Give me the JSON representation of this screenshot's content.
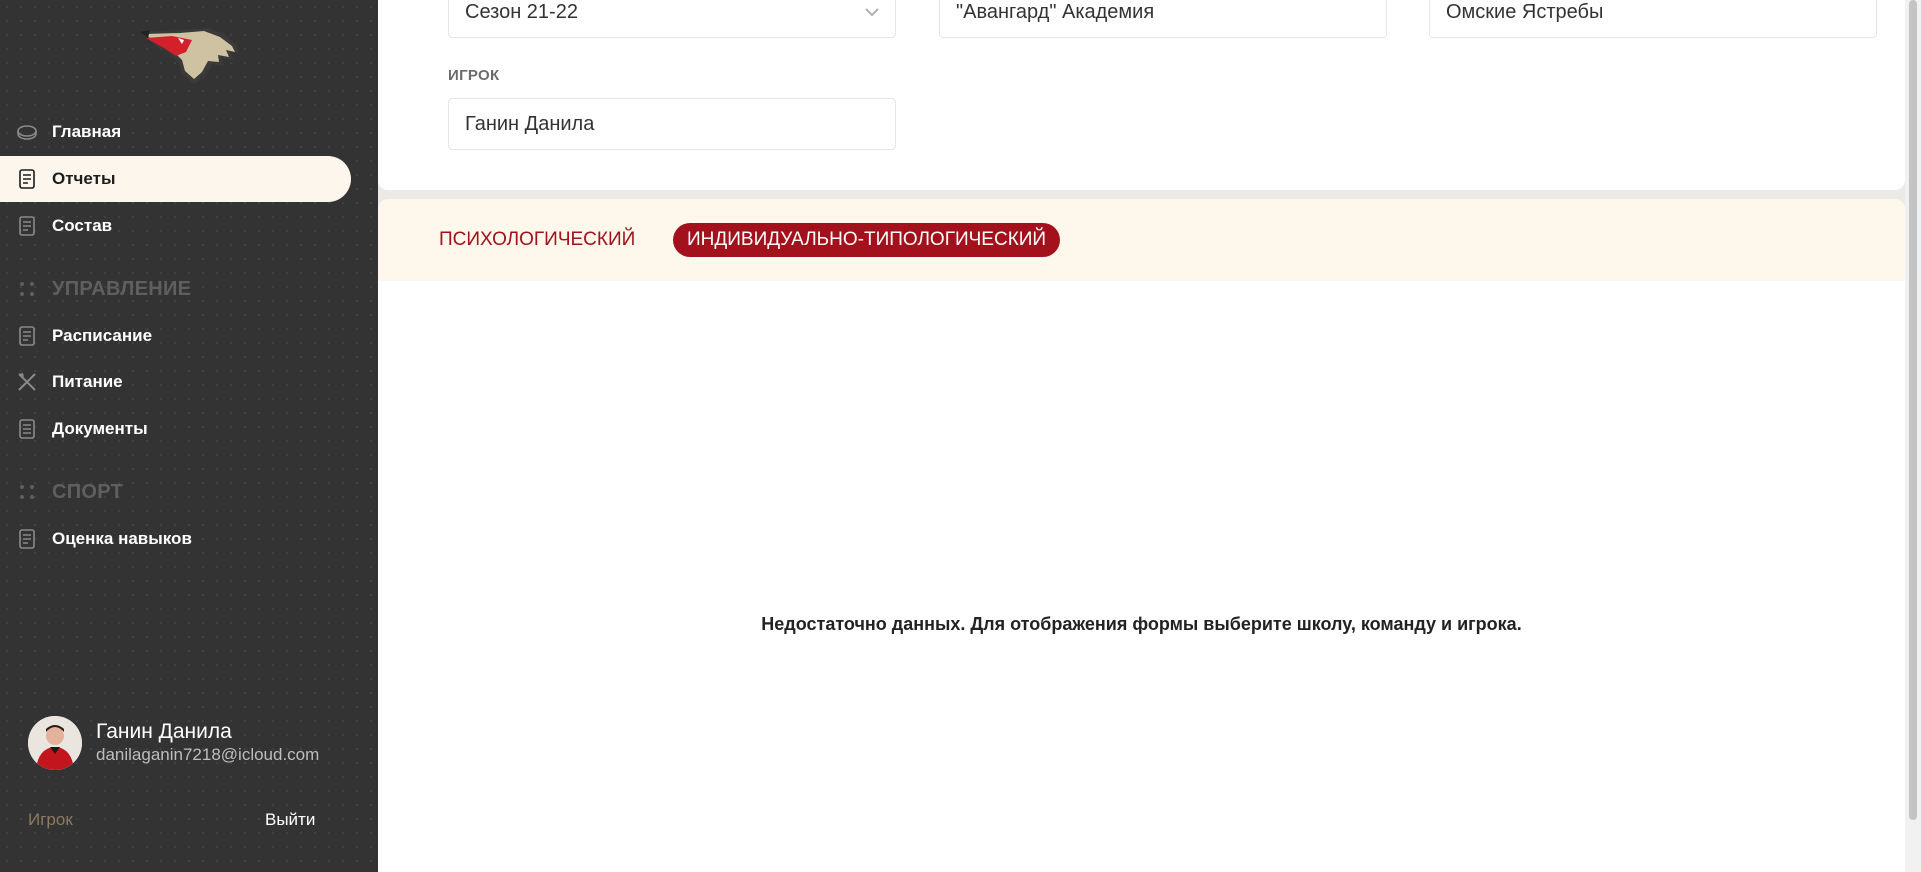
{
  "sidebar": {
    "nav": [
      {
        "label": "Главная",
        "icon": "puck-icon",
        "active": false
      },
      {
        "label": "Отчеты",
        "icon": "report-icon",
        "active": true
      },
      {
        "label": "Состав",
        "icon": "roster-icon",
        "active": false
      }
    ],
    "sections": [
      {
        "title": "УПРАВЛЕНИЕ",
        "items": [
          {
            "label": "Расписание",
            "icon": "schedule-icon"
          },
          {
            "label": "Питание",
            "icon": "fork-knife-icon"
          },
          {
            "label": "Документы",
            "icon": "document-icon"
          }
        ]
      },
      {
        "title": "СПОРТ",
        "items": [
          {
            "label": "Оценка навыков",
            "icon": "skills-icon"
          }
        ]
      }
    ],
    "user": {
      "name": "Ганин Данила",
      "email": "danilaganin7218@icloud.com",
      "role": "Игрок",
      "logout": "Выйти"
    }
  },
  "filters": {
    "season": "Сезон 21-22",
    "school": "\"Авангард\" Академия",
    "team": "Омские Ястребы",
    "player_label": "ИГРОК",
    "player": "Ганин Данила"
  },
  "tabs": [
    {
      "label": "ПСИХОЛОГИЧЕСКИЙ",
      "active": false
    },
    {
      "label": "ИНДИВИДУАЛЬНО-ТИПОЛОГИЧЕСКИЙ",
      "active": true
    }
  ],
  "empty_message": "Недостаточно данных. Для отображения формы выберите школу, команду и игрока.",
  "colors": {
    "sidebar_bg": "#333333",
    "accent": "#a3111c",
    "tabs_bg": "#fdf7ec",
    "active_nav_bg": "#fdf6ec"
  }
}
